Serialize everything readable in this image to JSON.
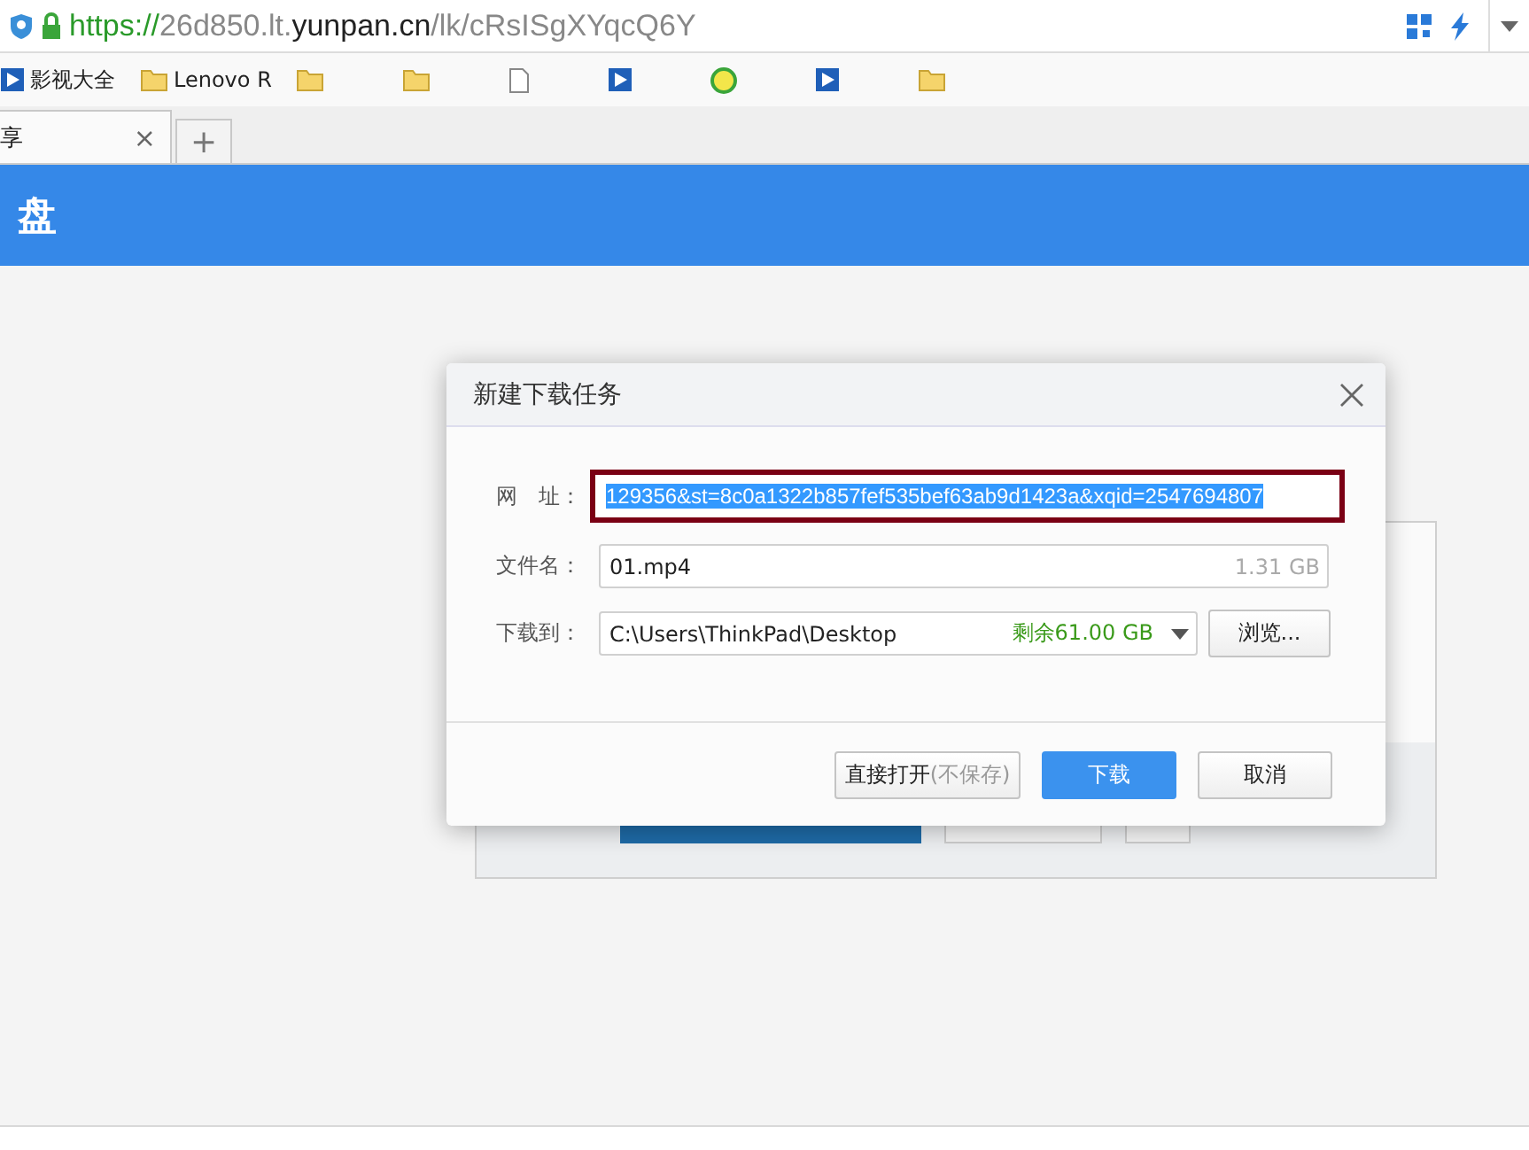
{
  "address_bar": {
    "scheme": "https://",
    "host": "26d850.lt.",
    "domain": "yunpan.cn",
    "path": "/lk/cRsISgXYqcQ6Y"
  },
  "bookmarks": [
    {
      "label": "影视大全",
      "kind": "app"
    },
    {
      "label": "Lenovo R",
      "kind": "folder"
    },
    {
      "kind": "folder"
    },
    {
      "kind": "folder"
    },
    {
      "kind": "page"
    },
    {
      "kind": "app"
    },
    {
      "kind": "round"
    },
    {
      "kind": "app"
    },
    {
      "kind": "folder"
    }
  ],
  "tabs": [
    {
      "label": "享",
      "close": "×",
      "selected": true
    }
  ],
  "new_tab": "+",
  "header": {
    "title": "盘"
  },
  "dialog": {
    "title": "新建下载任务",
    "url": {
      "label": "网　址：",
      "value": "129356&st=8c0a1322b857fef535bef63ab9d1423a&xqid=2547694807",
      "selected": true
    },
    "filename": {
      "label": "文件名：",
      "value": "01.mp4",
      "size": "1.31 GB"
    },
    "save_to": {
      "label": "下载到：",
      "value": "C:\\Users\\ThinkPad\\Desktop",
      "free": "剩余61.00 GB",
      "browse": "浏览..."
    },
    "buttons": [
      {
        "label": "直接打开",
        "note": "(不保存)",
        "kind": "secondary"
      },
      {
        "label": "下载",
        "kind": "primary"
      },
      {
        "label": "取消",
        "kind": "secondary"
      }
    ]
  }
}
